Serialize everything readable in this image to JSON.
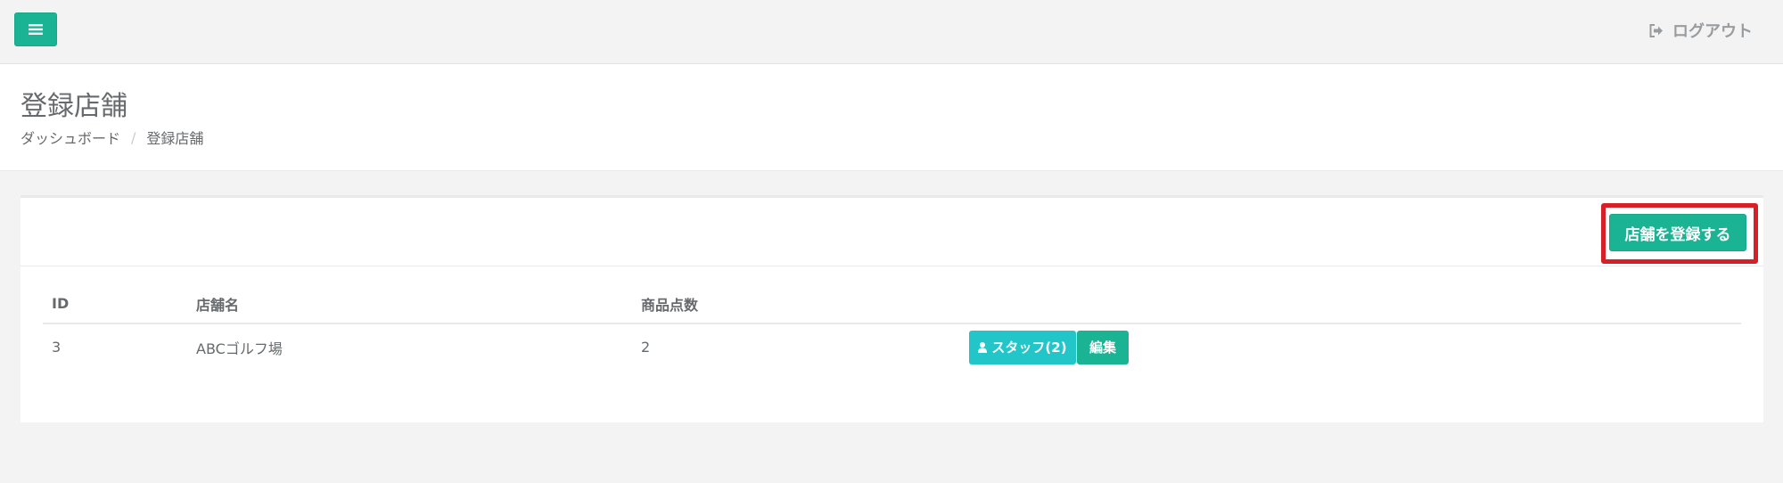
{
  "topbar": {
    "menu_icon": "hamburger-icon",
    "logout_icon": "sign-out-icon",
    "logout_label": "ログアウト"
  },
  "heading": {
    "title": "登録店舗",
    "breadcrumb": [
      "ダッシュボード",
      "登録店舗"
    ]
  },
  "panel": {
    "add_button_label": "店舗を登録する",
    "highlight_color": "#d61f26"
  },
  "table": {
    "columns": [
      "ID",
      "店舗名",
      "商品点数",
      ""
    ],
    "rows": [
      {
        "id": "3",
        "name": "ABCゴルフ場",
        "count": "2",
        "staff_label": "スタッフ(2)",
        "edit_label": "編集"
      }
    ]
  },
  "colors": {
    "primary": "#1ab394",
    "info": "#23c6c8",
    "text": "#676a6c"
  }
}
